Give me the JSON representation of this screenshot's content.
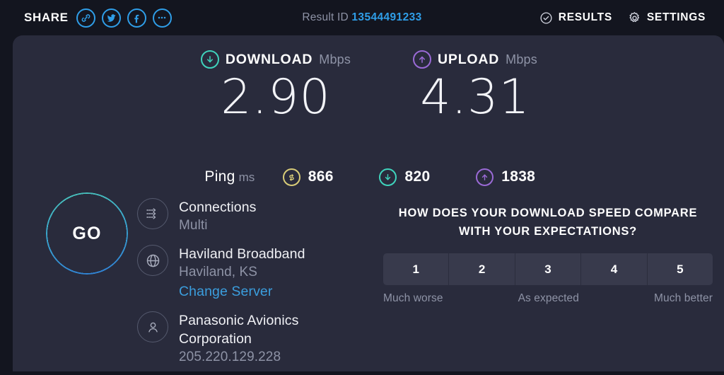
{
  "topbar": {
    "share_label": "SHARE",
    "share_icons": [
      {
        "name": "link-icon"
      },
      {
        "name": "twitter-icon"
      },
      {
        "name": "facebook-icon"
      },
      {
        "name": "more-icon"
      }
    ],
    "result_id_label": "Result ID",
    "result_id_value": "13544491233",
    "results_label": "RESULTS",
    "settings_label": "SETTINGS"
  },
  "speeds": {
    "download": {
      "kind": "DOWNLOAD",
      "unit": "Mbps",
      "value": "2.90",
      "color": "#3fd3bc",
      "icon": "arrow-down-circle-icon"
    },
    "upload": {
      "kind": "UPLOAD",
      "unit": "Mbps",
      "value": "4.31",
      "color": "#9a6ad6",
      "icon": "arrow-up-circle-icon"
    }
  },
  "ping": {
    "label": "Ping",
    "unit": "ms",
    "idle": {
      "value": "866",
      "color": "#d8cc78",
      "icon": "latency-idle-icon"
    },
    "download": {
      "value": "820",
      "color": "#3fd3bc",
      "icon": "arrow-down-circle-icon"
    },
    "upload": {
      "value": "1838",
      "color": "#9a6ad6",
      "icon": "arrow-up-circle-icon"
    }
  },
  "go_button": {
    "label": "GO",
    "ring_start_color": "#4ac4b8",
    "ring_end_color": "#2f7fd6"
  },
  "info": {
    "connections": {
      "icon": "multi-connection-icon",
      "title": "Connections",
      "subtitle": "Multi"
    },
    "server": {
      "icon": "globe-icon",
      "title": "Haviland Broadband",
      "subtitle": "Haviland, KS",
      "link": "Change Server"
    },
    "client": {
      "icon": "person-icon",
      "title": "Panasonic Avionics Corporation",
      "subtitle": "205.220.129.228"
    }
  },
  "survey": {
    "question_line1": "HOW DOES YOUR DOWNLOAD SPEED COMPARE",
    "question_line2": "WITH YOUR EXPECTATIONS?",
    "options": [
      "1",
      "2",
      "3",
      "4",
      "5"
    ],
    "legend_low": "Much worse",
    "legend_mid": "As expected",
    "legend_high": "Much better"
  }
}
